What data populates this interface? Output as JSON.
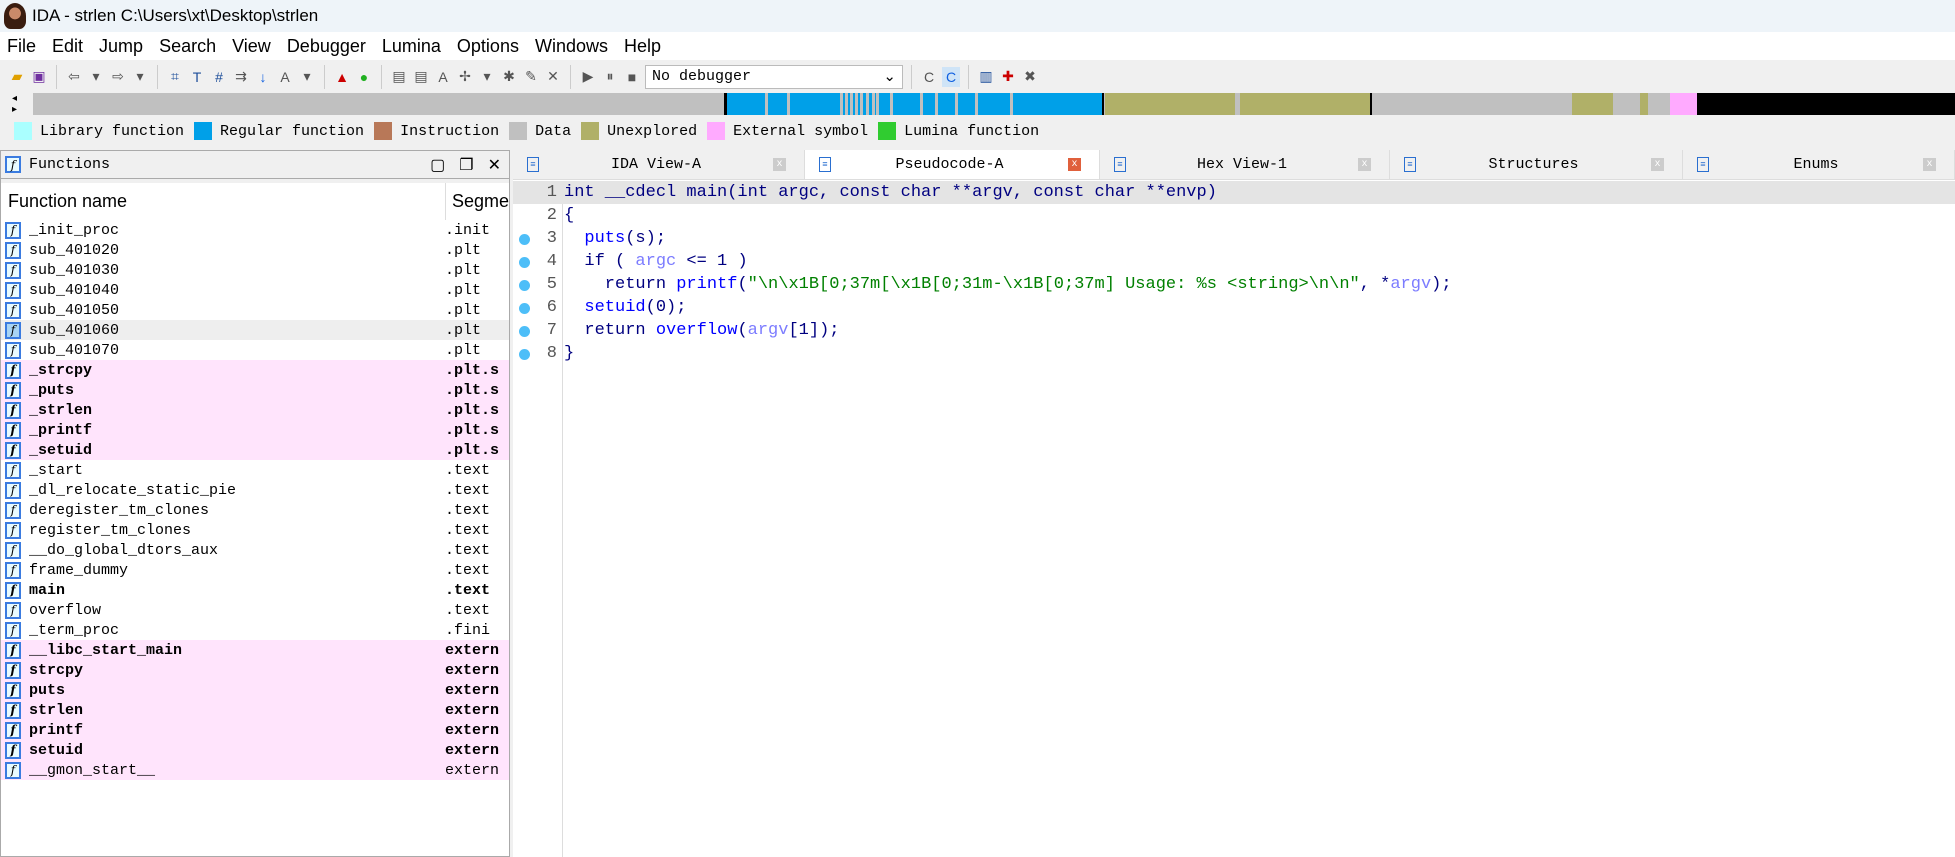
{
  "window": {
    "title": "IDA - strlen C:\\Users\\xt\\Desktop\\strlen"
  },
  "menu": [
    "File",
    "Edit",
    "Jump",
    "Search",
    "View",
    "Debugger",
    "Lumina",
    "Options",
    "Windows",
    "Help"
  ],
  "toolbar": {
    "debugger_select": "No debugger"
  },
  "legend": [
    {
      "label": "Library function",
      "color": "#aaffff"
    },
    {
      "label": "Regular function",
      "color": "#00a0e8"
    },
    {
      "label": "Instruction",
      "color": "#b87858"
    },
    {
      "label": "Data",
      "color": "#c0c0c0"
    },
    {
      "label": "Unexplored",
      "color": "#b0b068"
    },
    {
      "label": "External symbol",
      "color": "#ffaaff"
    },
    {
      "label": "Lumina function",
      "color": "#30cc30"
    }
  ],
  "functions": {
    "title": "Functions",
    "columns": [
      "Function name",
      "Segme"
    ],
    "rows": [
      {
        "name": "_init_proc",
        "segment": ".init"
      },
      {
        "name": "sub_401020",
        "segment": ".plt"
      },
      {
        "name": "sub_401030",
        "segment": ".plt"
      },
      {
        "name": "sub_401040",
        "segment": ".plt"
      },
      {
        "name": "sub_401050",
        "segment": ".plt"
      },
      {
        "name": "sub_401060",
        "segment": ".plt",
        "selected": true
      },
      {
        "name": "sub_401070",
        "segment": ".plt"
      },
      {
        "name": "_strcpy",
        "segment": ".plt.s",
        "style": "pink-bold"
      },
      {
        "name": "_puts",
        "segment": ".plt.s",
        "style": "pink-bold"
      },
      {
        "name": "_strlen",
        "segment": ".plt.s",
        "style": "pink-bold"
      },
      {
        "name": "_printf",
        "segment": ".plt.s",
        "style": "pink-bold"
      },
      {
        "name": "_setuid",
        "segment": ".plt.s",
        "style": "pink-bold"
      },
      {
        "name": "_start",
        "segment": ".text"
      },
      {
        "name": "_dl_relocate_static_pie",
        "segment": ".text"
      },
      {
        "name": "deregister_tm_clones",
        "segment": ".text"
      },
      {
        "name": "register_tm_clones",
        "segment": ".text"
      },
      {
        "name": "__do_global_dtors_aux",
        "segment": ".text"
      },
      {
        "name": "frame_dummy",
        "segment": ".text"
      },
      {
        "name": "main",
        "segment": ".text",
        "style": "bold"
      },
      {
        "name": "overflow",
        "segment": ".text"
      },
      {
        "name": "_term_proc",
        "segment": ".fini"
      },
      {
        "name": "__libc_start_main",
        "segment": "extern",
        "style": "pink-bold"
      },
      {
        "name": "strcpy",
        "segment": "extern",
        "style": "pink-bold"
      },
      {
        "name": "puts",
        "segment": "extern",
        "style": "pink-bold"
      },
      {
        "name": "strlen",
        "segment": "extern",
        "style": "pink-bold"
      },
      {
        "name": "printf",
        "segment": "extern",
        "style": "pink-bold"
      },
      {
        "name": "setuid",
        "segment": "extern",
        "style": "pink-bold"
      },
      {
        "name": "__gmon_start__",
        "segment": "extern",
        "style": "pink"
      }
    ]
  },
  "tabs": [
    {
      "label": "IDA View-A",
      "icon": "disasm-icon"
    },
    {
      "label": "Pseudocode-A",
      "icon": "pseudocode-icon",
      "active": true
    },
    {
      "label": "Hex View-1",
      "icon": "hex-icon"
    },
    {
      "label": "Structures",
      "icon": "structures-icon"
    },
    {
      "label": "Enums",
      "icon": "enums-icon"
    }
  ],
  "code": [
    {
      "n": "1",
      "bp": false,
      "parts": [
        [
          "kw",
          "int __cdecl main(int argc, const char **argv, const char **envp)"
        ]
      ]
    },
    {
      "n": "2",
      "bp": false,
      "parts": [
        [
          "kw",
          "{"
        ]
      ]
    },
    {
      "n": "3",
      "bp": true,
      "parts": [
        [
          "kw",
          "  "
        ],
        [
          "fn",
          "puts"
        ],
        [
          "kw",
          "(s);"
        ]
      ]
    },
    {
      "n": "4",
      "bp": true,
      "parts": [
        [
          "kw",
          "  if ( "
        ],
        [
          "var",
          "argc"
        ],
        [
          "kw",
          " <= 1 )"
        ]
      ]
    },
    {
      "n": "5",
      "bp": true,
      "parts": [
        [
          "kw",
          "    return "
        ],
        [
          "fn",
          "printf"
        ],
        [
          "kw",
          "("
        ],
        [
          "str",
          "\"\\n\\x1B[0;37m[\\x1B[0;31m-\\x1B[0;37m] Usage: %s <string>\\n\\n\""
        ],
        [
          "kw",
          ", *"
        ],
        [
          "var",
          "argv"
        ],
        [
          "kw",
          ");"
        ]
      ]
    },
    {
      "n": "6",
      "bp": true,
      "parts": [
        [
          "kw",
          "  "
        ],
        [
          "fn",
          "setuid"
        ],
        [
          "kw",
          "(0);"
        ]
      ]
    },
    {
      "n": "7",
      "bp": true,
      "parts": [
        [
          "kw",
          "  return "
        ],
        [
          "fn",
          "overflow"
        ],
        [
          "kw",
          "("
        ],
        [
          "var",
          "argv"
        ],
        [
          "kw",
          "[1]);"
        ]
      ]
    },
    {
      "n": "8",
      "bp": true,
      "parts": [
        [
          "kw",
          "}"
        ]
      ]
    }
  ]
}
